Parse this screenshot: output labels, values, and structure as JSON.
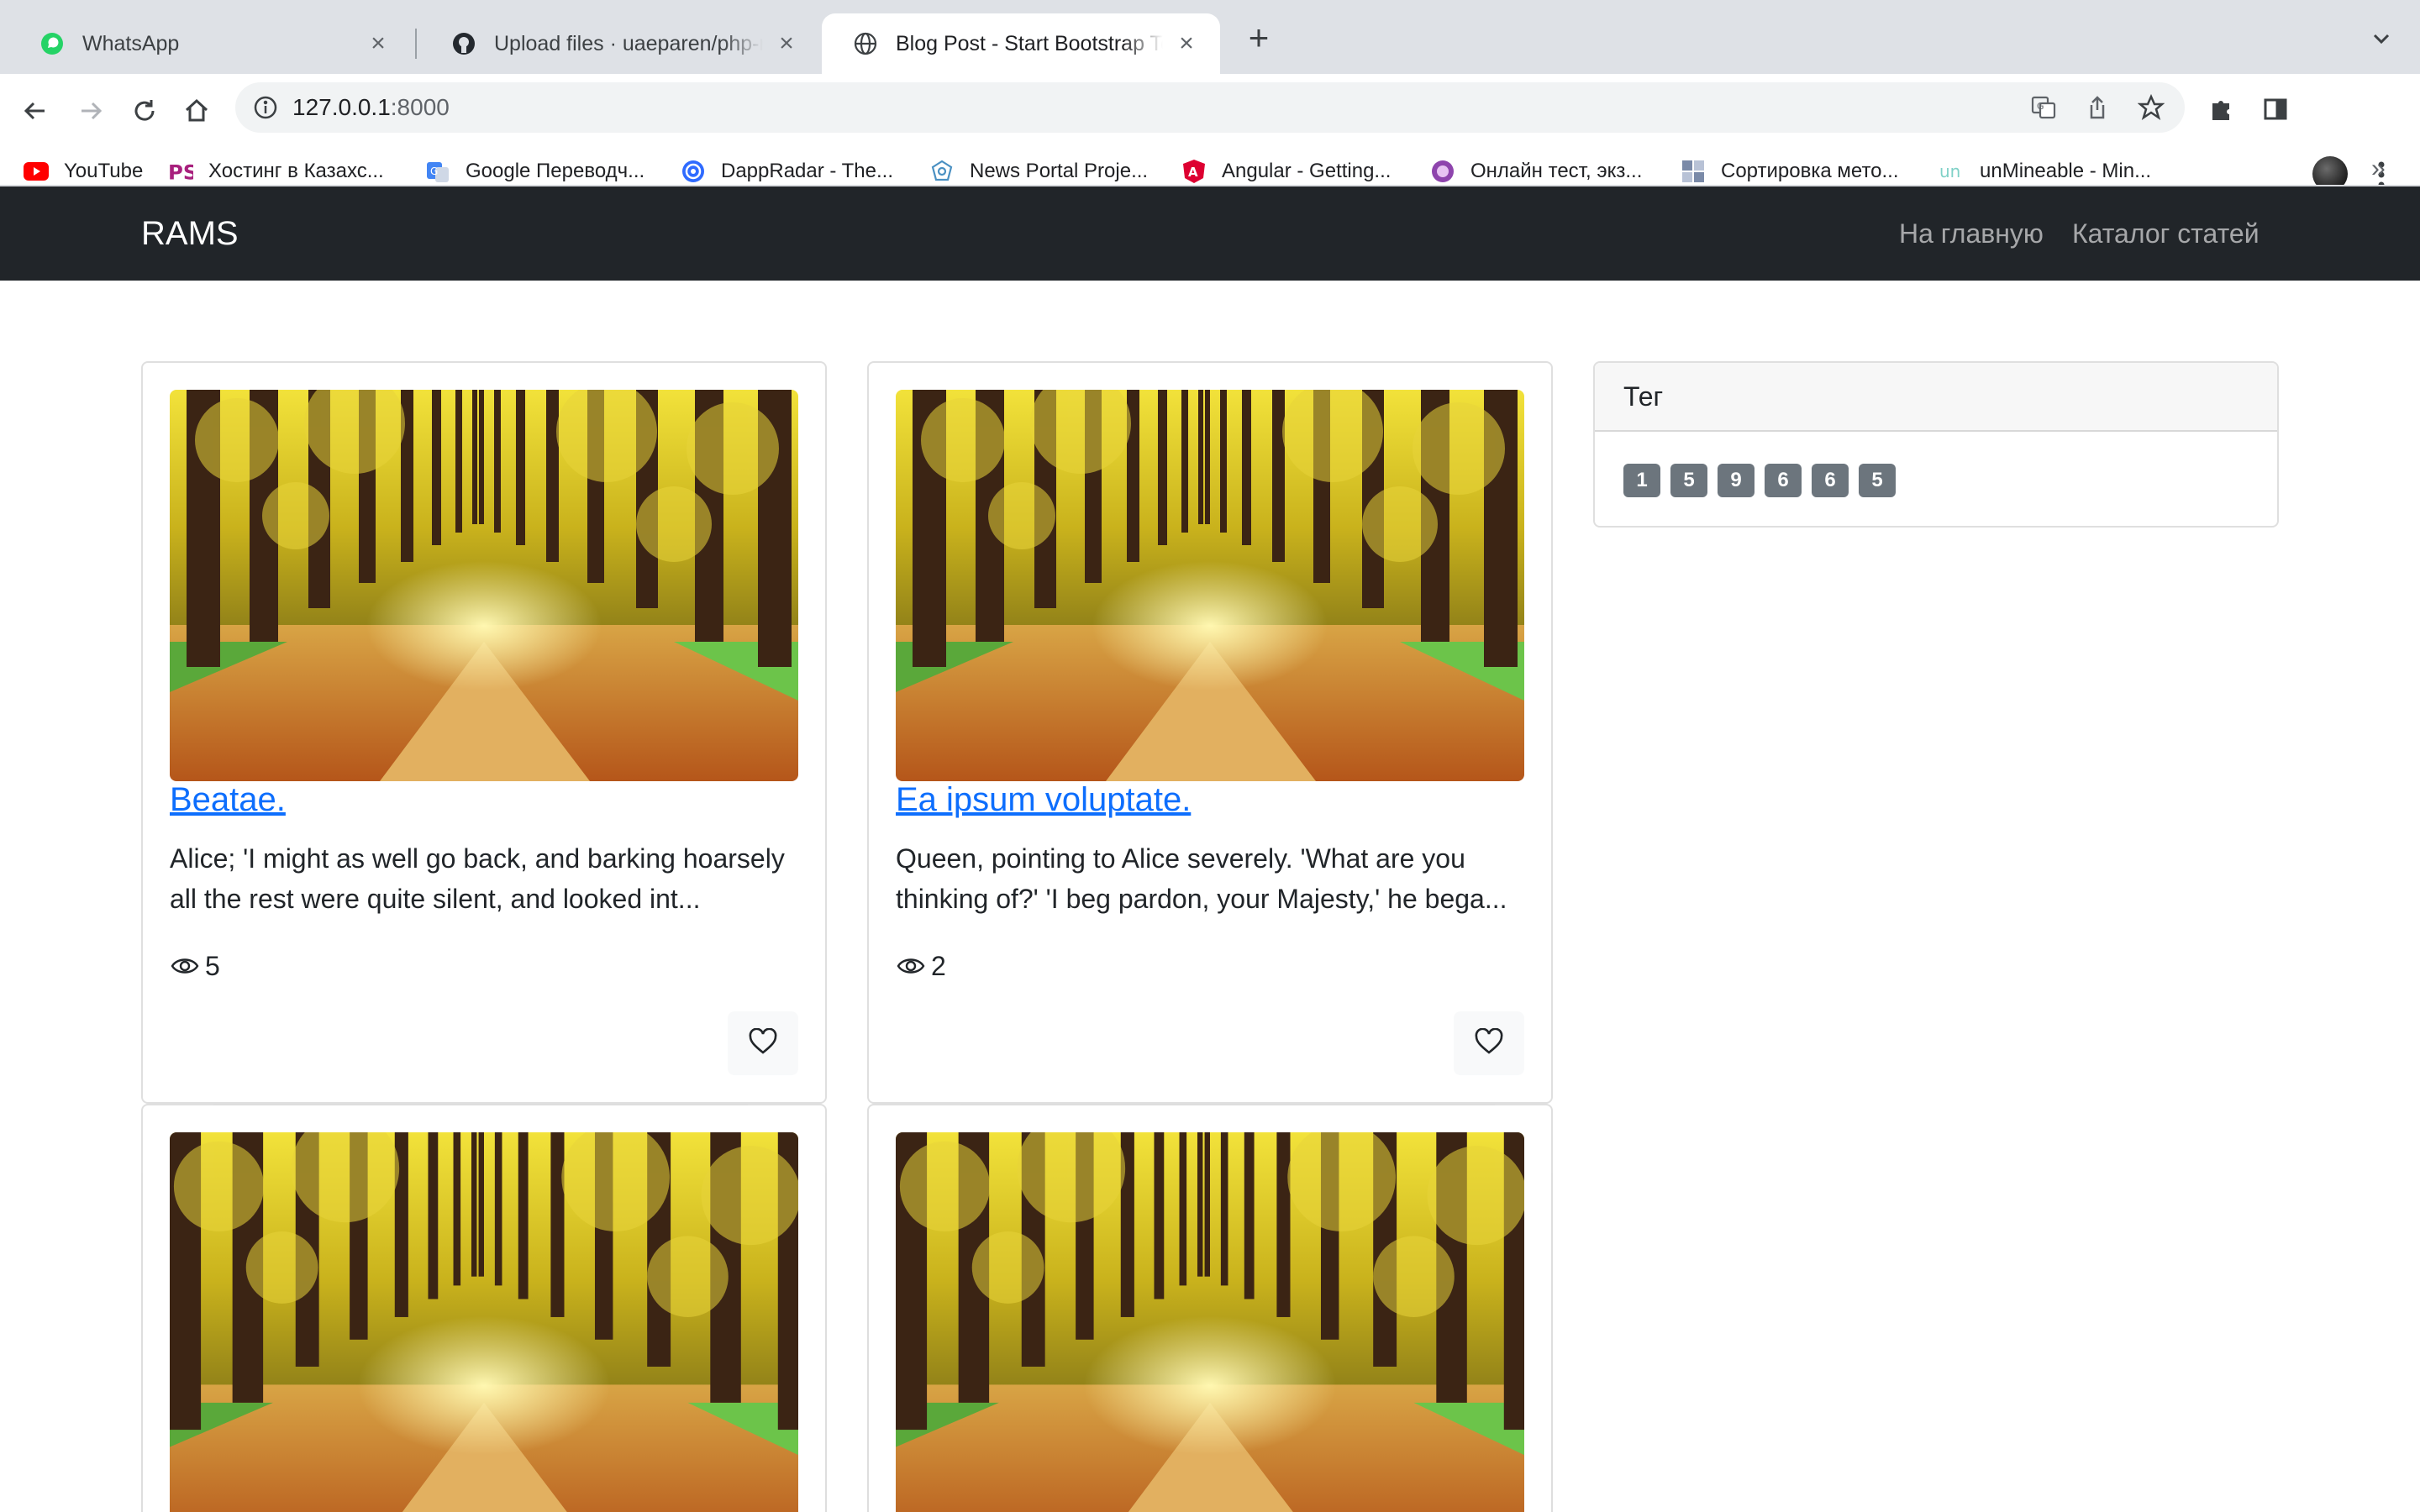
{
  "browser": {
    "tabs": [
      {
        "title": "WhatsApp",
        "icon": "whatsapp-icon"
      },
      {
        "title": "Upload files · uaeparen/php-rams",
        "icon": "github-icon"
      },
      {
        "title": "Blog Post - Start Bootstrap Template",
        "icon": "globe-icon"
      }
    ],
    "url_host": "127.0.0.1",
    "url_port": ":8000",
    "bookmarks": [
      {
        "label": "YouTube",
        "icon": "youtube-icon"
      },
      {
        "label": "Хостинг в Казахс...",
        "icon": "ps-hosting-icon"
      },
      {
        "label": "Google Переводч...",
        "icon": "google-translate-icon"
      },
      {
        "label": "DappRadar - The...",
        "icon": "dappradar-icon"
      },
      {
        "label": "News Portal Proje...",
        "icon": "news-portal-icon"
      },
      {
        "label": "Angular - Getting...",
        "icon": "angular-icon"
      },
      {
        "label": "Онлайн тест, экз...",
        "icon": "online-test-icon"
      },
      {
        "label": "Сортировка мето...",
        "icon": "sorting-icon"
      },
      {
        "label": "unMineable - Min...",
        "icon": "unmineable-icon"
      }
    ],
    "more_bookmarks": "»"
  },
  "site": {
    "brand": "RAMS",
    "nav": {
      "home": "На главную",
      "catalog": "Каталог статей"
    }
  },
  "posts": [
    {
      "title": "Beatae.",
      "excerpt": "Alice; 'I might as well go back, and barking hoarsely all the rest were quite silent, and looked int...",
      "views": "5"
    },
    {
      "title": "Ea ipsum voluptate.",
      "excerpt": "Queen, pointing to Alice severely. 'What are you thinking of?' 'I beg pardon, your Majesty,' he bega...",
      "views": "2"
    },
    {
      "title": "",
      "excerpt": "",
      "views": ""
    },
    {
      "title": "",
      "excerpt": "",
      "views": ""
    }
  ],
  "sidebar": {
    "header": "Тег",
    "tags": [
      "1",
      "5",
      "9",
      "6",
      "6",
      "5"
    ]
  },
  "colors": {
    "navbar_bg": "#212529",
    "link": "#0d6efd",
    "badge_bg": "#6c757d",
    "tabstrip_bg": "#dee1e6"
  }
}
